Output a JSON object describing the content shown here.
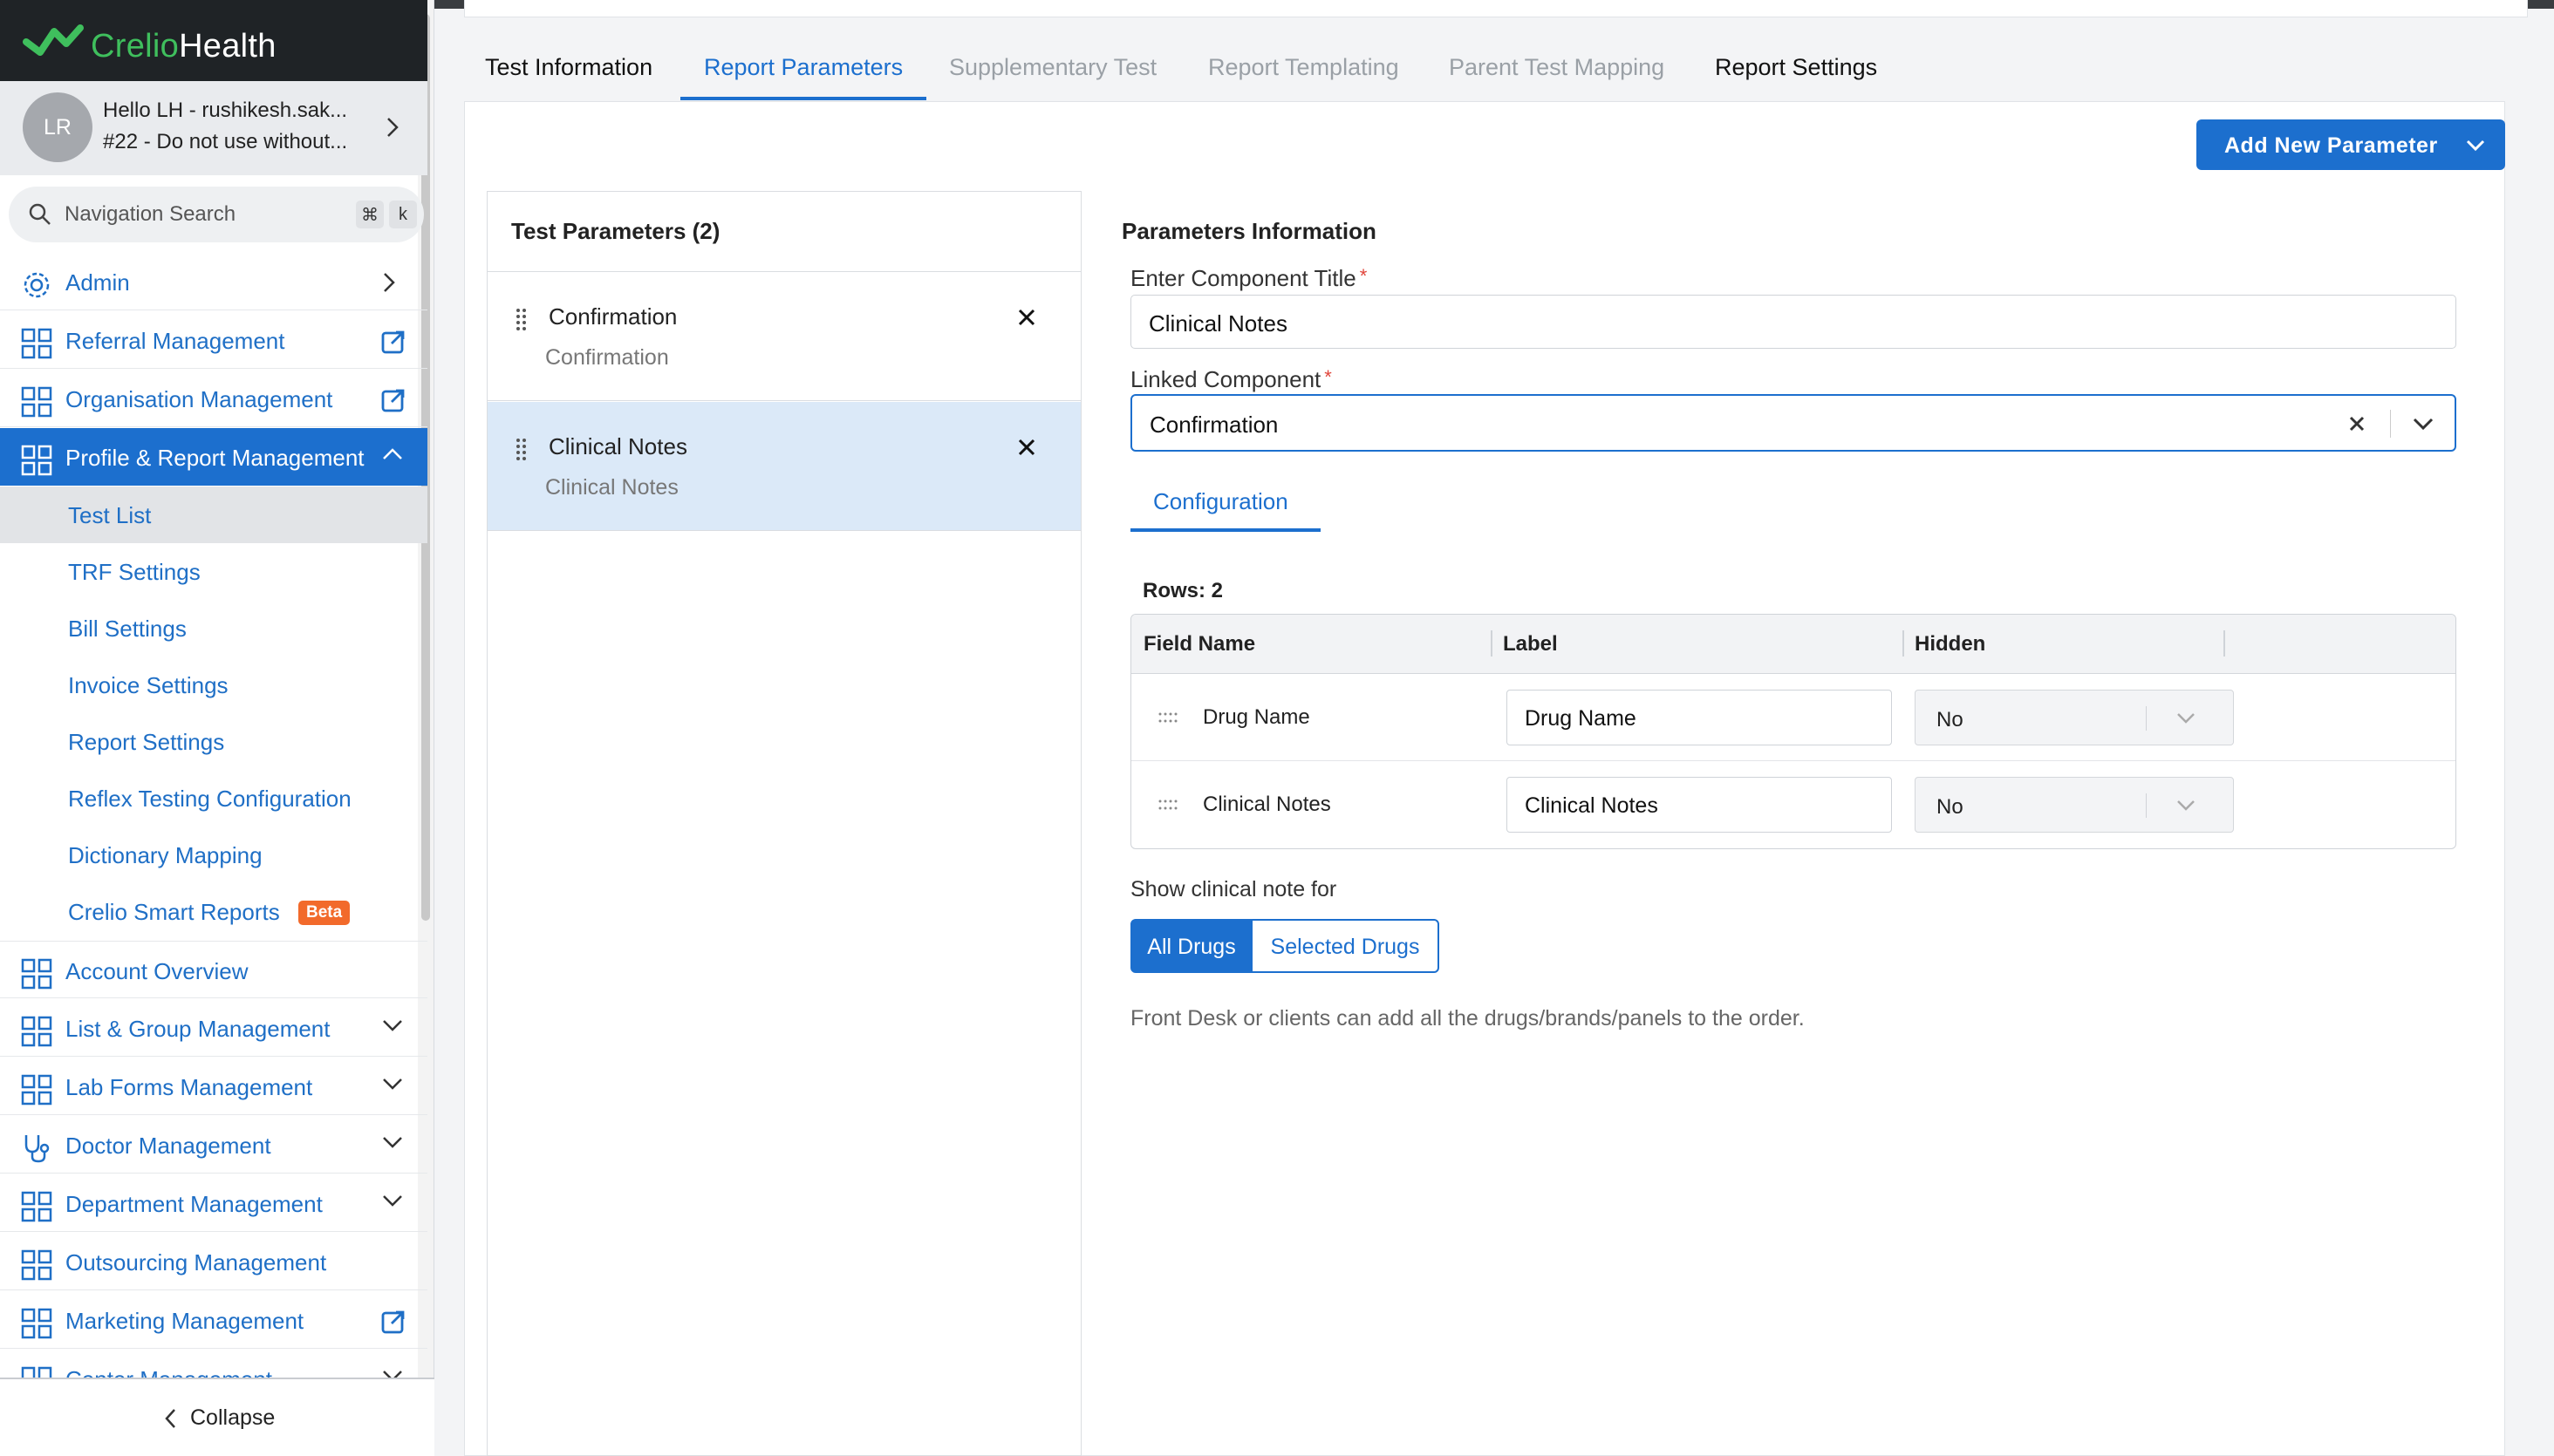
{
  "brand": {
    "name_part1": "Crelio",
    "name_part2": "Health",
    "accent": "#3fbf5d"
  },
  "user": {
    "initials": "LR",
    "greeting": "Hello LH - rushikesh.sak...",
    "org": "#22 - Do not use without..."
  },
  "search": {
    "placeholder": "Navigation Search",
    "key1": "⌘",
    "key2": "k"
  },
  "nav": {
    "admin": "Admin",
    "referral": "Referral Management",
    "organisation": "Organisation Management",
    "profile_report": "Profile & Report Management",
    "sub": {
      "test_list": "Test List",
      "trf_settings": "TRF Settings",
      "bill_settings": "Bill Settings",
      "invoice_settings": "Invoice Settings",
      "report_settings": "Report Settings",
      "reflex_testing": "Reflex Testing Configuration",
      "dictionary_mapping": "Dictionary Mapping",
      "smart_reports": "Crelio Smart Reports",
      "beta": "Beta"
    },
    "account_overview": "Account Overview",
    "list_group": "List & Group Management",
    "lab_forms": "Lab Forms Management",
    "doctor": "Doctor Management",
    "department": "Department Management",
    "outsourcing": "Outsourcing Management",
    "marketing": "Marketing Management",
    "center": "Center Management",
    "collapse": "Collapse"
  },
  "tabs": {
    "test_information": "Test Information",
    "report_parameters": "Report Parameters",
    "supplementary_test": "Supplementary Test",
    "report_templating": "Report Templating",
    "parent_test_mapping": "Parent Test Mapping",
    "report_settings": "Report Settings"
  },
  "add_parameter_button": "Add New Parameter",
  "test_parameters": {
    "title": "Test Parameters (2)",
    "items": [
      {
        "name": "Confirmation",
        "sub": "Confirmation"
      },
      {
        "name": "Clinical Notes",
        "sub": "Clinical Notes"
      }
    ]
  },
  "parameters_info": {
    "title": "Parameters Information",
    "component_title_label": "Enter Component Title",
    "component_title_value": "Clinical Notes",
    "linked_component_label": "Linked Component",
    "linked_component_value": "Confirmation",
    "required_mark": "*",
    "config_tab": "Configuration",
    "rows_label": "Rows: 2",
    "table": {
      "headers": {
        "field_name": "Field Name",
        "label": "Label",
        "hidden": "Hidden"
      },
      "rows": [
        {
          "field": "Drug Name",
          "label": "Drug Name",
          "hidden": "No"
        },
        {
          "field": "Clinical Notes",
          "label": "Clinical Notes",
          "hidden": "No"
        }
      ]
    },
    "show_note_label": "Show clinical note for",
    "seg_all": "All Drugs",
    "seg_selected": "Selected Drugs",
    "hint": "Front Desk or clients can add all the drugs/brands/panels to the order."
  },
  "colors": {
    "primary": "#1c6fce",
    "selected_row": "#dbe9f8",
    "beta": "#f26a2b"
  }
}
